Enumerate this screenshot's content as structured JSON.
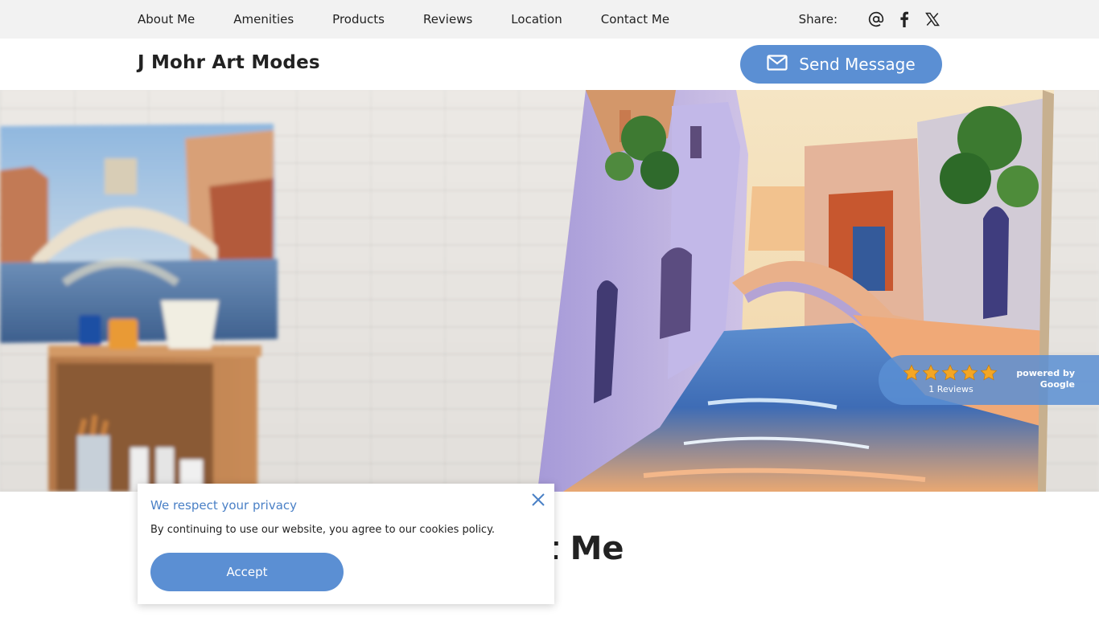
{
  "nav": {
    "items": [
      {
        "label": "About Me"
      },
      {
        "label": "Amenities"
      },
      {
        "label": "Products"
      },
      {
        "label": "Reviews"
      },
      {
        "label": "Location"
      },
      {
        "label": "Contact Me"
      }
    ],
    "share_label": "Share:",
    "share_icons": [
      "email-icon",
      "facebook-icon",
      "x-icon"
    ]
  },
  "header": {
    "site_title": "J Mohr Art Modes",
    "send_message_label": "Send Message"
  },
  "hero": {
    "rating": {
      "stars": 5,
      "reviews_text": "1 Reviews",
      "powered_by_line1": "powered by",
      "powered_by_line2": "Google"
    }
  },
  "main": {
    "section_heading": "About Me"
  },
  "cookie": {
    "title": "We respect your privacy",
    "text": "By continuing to use our website, you agree to our cookies policy.",
    "accept_label": "Accept"
  },
  "colors": {
    "accent": "#5b8fd3",
    "star": "#f4a623",
    "topbar_bg": "#f2f2f2"
  }
}
